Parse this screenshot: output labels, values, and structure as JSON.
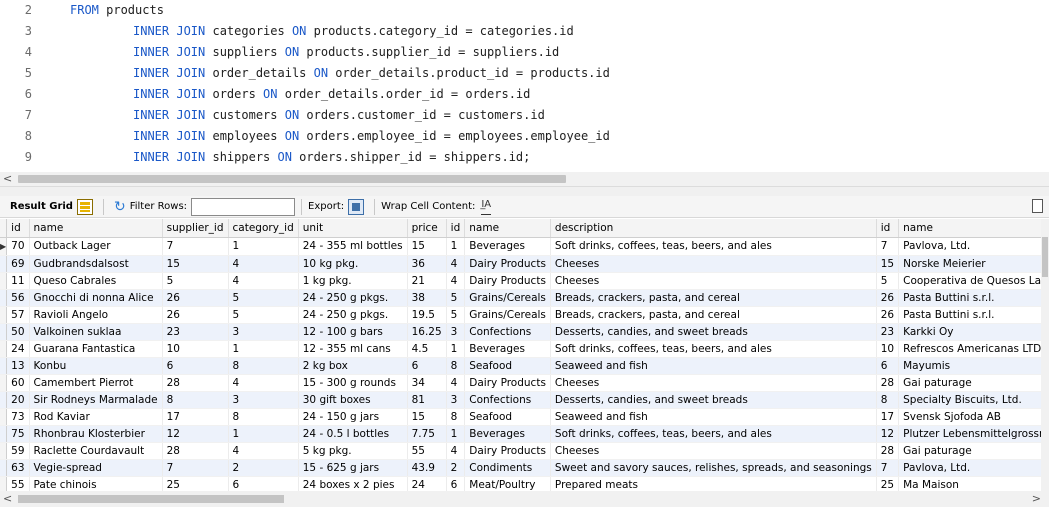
{
  "editor": {
    "lines": [
      {
        "num": "2",
        "indent": false,
        "parts": [
          [
            "kw",
            "FROM"
          ],
          [
            "id",
            " products"
          ]
        ]
      },
      {
        "num": "3",
        "indent": true,
        "parts": [
          [
            "kw",
            "INNER JOIN"
          ],
          [
            "id",
            " categories "
          ],
          [
            "kw",
            "ON"
          ],
          [
            "id",
            " products.category_id = categories.id"
          ]
        ]
      },
      {
        "num": "4",
        "indent": true,
        "parts": [
          [
            "kw",
            "INNER JOIN"
          ],
          [
            "id",
            " suppliers "
          ],
          [
            "kw",
            "ON"
          ],
          [
            "id",
            " products.supplier_id = suppliers.id"
          ]
        ]
      },
      {
        "num": "5",
        "indent": true,
        "parts": [
          [
            "kw",
            "INNER JOIN"
          ],
          [
            "id",
            " order_details "
          ],
          [
            "kw",
            "ON"
          ],
          [
            "id",
            " order_details.product_id = products.id"
          ]
        ]
      },
      {
        "num": "6",
        "indent": true,
        "parts": [
          [
            "kw",
            "INNER JOIN"
          ],
          [
            "id",
            " orders "
          ],
          [
            "kw",
            "ON"
          ],
          [
            "id",
            " order_details.order_id = orders.id"
          ]
        ]
      },
      {
        "num": "7",
        "indent": true,
        "parts": [
          [
            "kw",
            "INNER JOIN"
          ],
          [
            "id",
            " customers "
          ],
          [
            "kw",
            "ON"
          ],
          [
            "id",
            " orders.customer_id = customers.id"
          ]
        ]
      },
      {
        "num": "8",
        "indent": true,
        "parts": [
          [
            "kw",
            "INNER JOIN"
          ],
          [
            "id",
            " employees "
          ],
          [
            "kw",
            "ON"
          ],
          [
            "id",
            " orders.employee_id = employees.employee_id"
          ]
        ]
      },
      {
        "num": "9",
        "indent": true,
        "parts": [
          [
            "kw",
            "INNER JOIN"
          ],
          [
            "id",
            " shippers "
          ],
          [
            "kw",
            "ON"
          ],
          [
            "id",
            " orders.shipper_id = shippers.id;"
          ]
        ]
      }
    ]
  },
  "toolbar": {
    "result_grid_label": "Result Grid",
    "filter_rows_label": "Filter Rows:",
    "filter_rows_value": "",
    "export_label": "Export:",
    "wrap_cell_label": "Wrap Cell Content:",
    "wrap_icon_glyph": "I̲A"
  },
  "grid": {
    "columns": [
      "id",
      "name",
      "supplier_id",
      "category_id",
      "unit",
      "price",
      "id",
      "name",
      "description",
      "id",
      "name"
    ],
    "rows": [
      [
        "70",
        "Outback Lager",
        "7",
        "1",
        "24 - 355 ml bottles",
        "15",
        "1",
        "Beverages",
        "Soft drinks, coffees, teas, beers, and ales",
        "7",
        "Pavlova, Ltd."
      ],
      [
        "69",
        "Gudbrandsdalsost",
        "15",
        "4",
        "10 kg pkg.",
        "36",
        "4",
        "Dairy Products",
        "Cheeses",
        "15",
        "Norske Meierier"
      ],
      [
        "11",
        "Queso Cabrales",
        "5",
        "4",
        "1 kg pkg.",
        "21",
        "4",
        "Dairy Products",
        "Cheeses",
        "5",
        "Cooperativa de Quesos Las Cabras"
      ],
      [
        "56",
        "Gnocchi di nonna Alice",
        "26",
        "5",
        "24 - 250 g pkgs.",
        "38",
        "5",
        "Grains/Cereals",
        "Breads, crackers, pasta, and cereal",
        "26",
        "Pasta Buttini s.r.l."
      ],
      [
        "57",
        "Ravioli Angelo",
        "26",
        "5",
        "24 - 250 g pkgs.",
        "19.5",
        "5",
        "Grains/Cereals",
        "Breads, crackers, pasta, and cereal",
        "26",
        "Pasta Buttini s.r.l."
      ],
      [
        "50",
        "Valkoinen suklaa",
        "23",
        "3",
        "12 - 100 g bars",
        "16.25",
        "3",
        "Confections",
        "Desserts, candies, and sweet breads",
        "23",
        "Karkki Oy"
      ],
      [
        "24",
        "Guarana Fantastica",
        "10",
        "1",
        "12 - 355 ml cans",
        "4.5",
        "1",
        "Beverages",
        "Soft drinks, coffees, teas, beers, and ales",
        "10",
        "Refrescos Americanas LTDA"
      ],
      [
        "13",
        "Konbu",
        "6",
        "8",
        "2 kg box",
        "6",
        "8",
        "Seafood",
        "Seaweed and fish",
        "6",
        "Mayumis"
      ],
      [
        "60",
        "Camembert Pierrot",
        "28",
        "4",
        "15 - 300 g rounds",
        "34",
        "4",
        "Dairy Products",
        "Cheeses",
        "28",
        "Gai paturage"
      ],
      [
        "20",
        "Sir Rodneys Marmalade",
        "8",
        "3",
        "30 gift boxes",
        "81",
        "3",
        "Confections",
        "Desserts, candies, and sweet breads",
        "8",
        "Specialty Biscuits, Ltd."
      ],
      [
        "73",
        "Rod Kaviar",
        "17",
        "8",
        "24 - 150 g jars",
        "15",
        "8",
        "Seafood",
        "Seaweed and fish",
        "17",
        "Svensk Sjofoda AB"
      ],
      [
        "75",
        "Rhonbrau Klosterbier",
        "12",
        "1",
        "24 - 0.5 l bottles",
        "7.75",
        "1",
        "Beverages",
        "Soft drinks, coffees, teas, beers, and ales",
        "12",
        "Plutzer Lebensmittelgrossmarkte AG"
      ],
      [
        "59",
        "Raclette Courdavault",
        "28",
        "4",
        "5 kg pkg.",
        "55",
        "4",
        "Dairy Products",
        "Cheeses",
        "28",
        "Gai paturage"
      ],
      [
        "63",
        "Vegie-spread",
        "7",
        "2",
        "15 - 625 g jars",
        "43.9",
        "2",
        "Condiments",
        "Sweet and savory sauces, relishes, spreads, and seasonings",
        "7",
        "Pavlova, Ltd."
      ],
      [
        "55",
        "Pate chinois",
        "25",
        "6",
        "24 boxes x 2 pies",
        "24",
        "6",
        "Meat/Poultry",
        "Prepared meats",
        "25",
        "Ma Maison"
      ]
    ]
  },
  "icons": {
    "row_arrow": "▶",
    "refresh": "↻",
    "scroll_left": "<",
    "scroll_right": ">"
  }
}
